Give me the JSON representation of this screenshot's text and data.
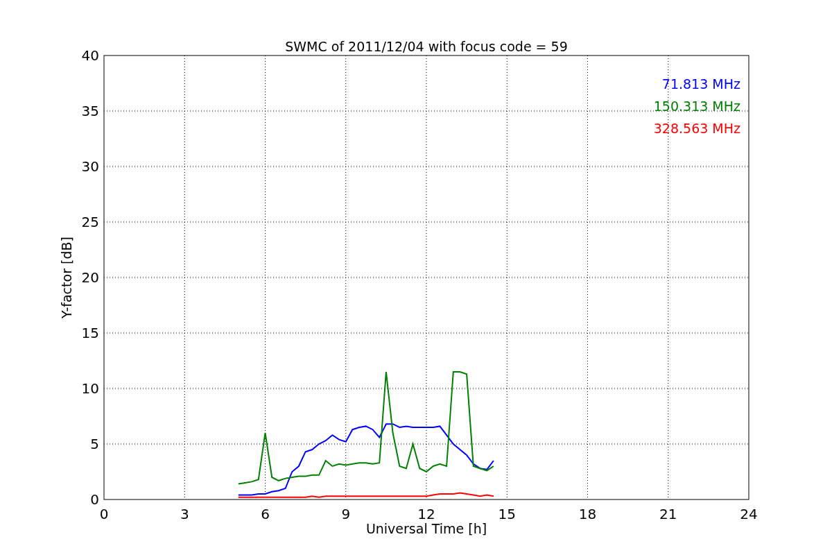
{
  "chart_data": {
    "type": "line",
    "title": "SWMC of 2011/12/04 with focus code = 59",
    "xlabel": "Universal Time [h]",
    "ylabel": "Y-factor [dB]",
    "x": [
      5,
      5.25,
      5.5,
      5.75,
      6,
      6.25,
      6.5,
      6.75,
      7,
      7.25,
      7.5,
      7.75,
      8,
      8.25,
      8.5,
      8.75,
      9,
      9.25,
      9.5,
      9.75,
      10,
      10.25,
      10.5,
      10.75,
      11,
      11.25,
      11.5,
      11.75,
      12,
      12.25,
      12.5,
      12.75,
      13,
      13.25,
      13.5,
      13.75,
      14,
      14.25,
      14.5
    ],
    "series": [
      {
        "name": "71.813 MHz",
        "color": "#0000ff",
        "values": [
          0.4,
          0.4,
          0.4,
          0.5,
          0.5,
          0.7,
          0.8,
          1.0,
          2.5,
          3.0,
          4.3,
          4.5,
          5.0,
          5.3,
          5.8,
          5.4,
          5.2,
          6.3,
          6.5,
          6.6,
          6.3,
          5.6,
          6.8,
          6.8,
          6.5,
          6.6,
          6.5,
          6.5,
          6.5,
          6.5,
          6.6,
          5.8,
          5.0,
          4.5,
          4.0,
          3.2,
          2.8,
          2.7,
          3.5
        ]
      },
      {
        "name": "150.313 MHz",
        "color": "#008000",
        "values": [
          1.4,
          1.5,
          1.6,
          1.8,
          6.0,
          2.0,
          1.7,
          1.9,
          2.0,
          2.1,
          2.1,
          2.2,
          2.2,
          3.5,
          3.0,
          3.2,
          3.1,
          3.2,
          3.3,
          3.3,
          3.2,
          3.3,
          11.5,
          6.0,
          3.0,
          2.8,
          5.0,
          2.8,
          2.5,
          3.0,
          3.2,
          3.0,
          11.5,
          11.5,
          11.3,
          3.0,
          2.8,
          2.6,
          3.0
        ]
      },
      {
        "name": "328.563 MHz",
        "color": "#ff0000",
        "values": [
          0.2,
          0.2,
          0.2,
          0.2,
          0.2,
          0.2,
          0.2,
          0.2,
          0.2,
          0.2,
          0.2,
          0.3,
          0.2,
          0.3,
          0.3,
          0.3,
          0.3,
          0.3,
          0.3,
          0.3,
          0.3,
          0.3,
          0.3,
          0.3,
          0.3,
          0.3,
          0.3,
          0.3,
          0.3,
          0.4,
          0.5,
          0.5,
          0.5,
          0.6,
          0.5,
          0.4,
          0.3,
          0.4,
          0.3
        ]
      }
    ],
    "xlim": [
      0,
      24
    ],
    "ylim": [
      0,
      40
    ],
    "xticks": [
      0,
      3,
      6,
      9,
      12,
      15,
      18,
      21,
      24
    ],
    "yticks": [
      0,
      5,
      10,
      15,
      20,
      25,
      30,
      35,
      40
    ],
    "grid": true
  }
}
